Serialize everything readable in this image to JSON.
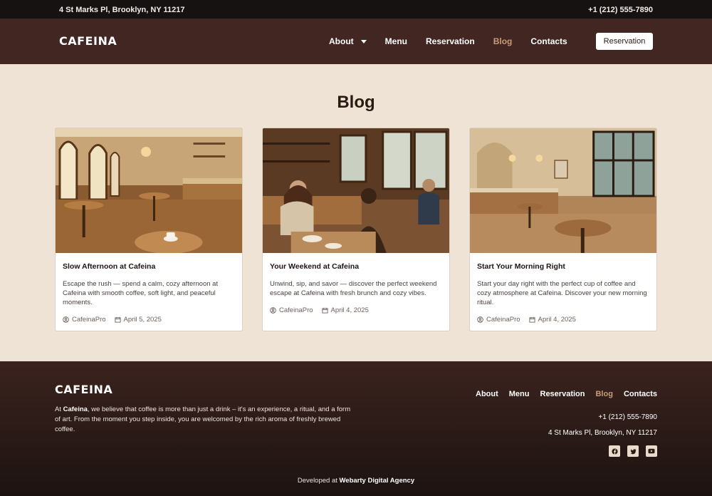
{
  "topbar": {
    "address": "4 St Marks Pl, Brooklyn, NY 11217",
    "phone": "+1 (212) 555-7890"
  },
  "header": {
    "logo": "CAFEINA",
    "nav": [
      {
        "label": "About"
      },
      {
        "label": "Menu"
      },
      {
        "label": "Reservation"
      },
      {
        "label": "Blog",
        "active": true
      },
      {
        "label": "Contacts"
      }
    ],
    "cta_label": "Reservation"
  },
  "main": {
    "title": "Blog",
    "posts": [
      {
        "title": "Slow Afternoon at Cafeina",
        "excerpt": "Escape the rush — spend a calm, cozy afternoon at Cafeina with smooth coffee, soft light, and peaceful moments.",
        "author": "CafeinaPro",
        "date": "April 5, 2025"
      },
      {
        "title": "Your Weekend at Cafeina",
        "excerpt": "Unwind, sip, and savor — discover the perfect weekend escape at Cafeina with fresh brunch and cozy vibes.",
        "author": "CafeinaPro",
        "date": "April 4, 2025"
      },
      {
        "title": "Start Your Morning Right",
        "excerpt": "Start your day right with the perfect cup of coffee and cozy atmosphere at Cafeina. Discover your new morning ritual.",
        "author": "CafeinaPro",
        "date": "April 4, 2025"
      }
    ]
  },
  "footer": {
    "logo": "CAFEINA",
    "about_prefix": "At ",
    "about_brand": "Cafeina",
    "about_text": ", we believe that coffee is more than just a drink – it's an experience, a ritual, and a form of art. From the moment you step inside, you are welcomed by the rich aroma of freshly brewed coffee.",
    "nav": [
      {
        "label": "About"
      },
      {
        "label": "Menu"
      },
      {
        "label": "Reservation"
      },
      {
        "label": "Blog",
        "active": true
      },
      {
        "label": "Contacts"
      }
    ],
    "phone": "+1 (212) 555-7890",
    "address": "4 St Marks Pl, Brooklyn, NY 11217",
    "socials": [
      "facebook-icon",
      "twitter-icon",
      "youtube-icon"
    ],
    "credit_prefix": "Developed at ",
    "credit_agency": "Webarty Digital Agency"
  },
  "colors": {
    "topbar": "#161212",
    "header": "#422621",
    "page_bg": "#efe3d6",
    "accent": "#c89b7a"
  }
}
